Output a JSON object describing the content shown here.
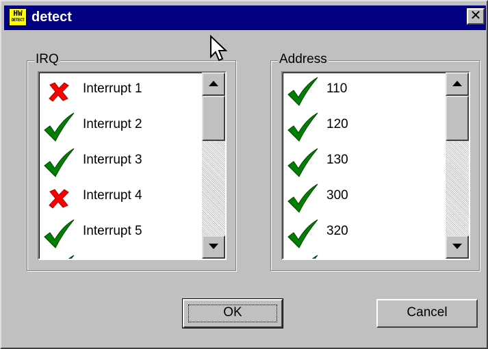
{
  "window": {
    "title": "detect",
    "icon_text_top": "HW",
    "icon_text_bottom": "DETECT",
    "close_glyph": "✕"
  },
  "irq_group": {
    "label": "IRQ",
    "items": [
      {
        "status": "fail",
        "label": "Interrupt 1"
      },
      {
        "status": "ok",
        "label": "Interrupt 2"
      },
      {
        "status": "ok",
        "label": "Interrupt 3"
      },
      {
        "status": "fail",
        "label": "Interrupt 4"
      },
      {
        "status": "ok",
        "label": "Interrupt 5"
      },
      {
        "status": "ok",
        "label": ""
      }
    ]
  },
  "address_group": {
    "label": "Address",
    "items": [
      {
        "status": "ok",
        "label": "110"
      },
      {
        "status": "ok",
        "label": "120"
      },
      {
        "status": "ok",
        "label": "130"
      },
      {
        "status": "ok",
        "label": "300"
      },
      {
        "status": "ok",
        "label": "320"
      },
      {
        "status": "ok",
        "label": ""
      }
    ]
  },
  "buttons": {
    "ok_label": "OK",
    "cancel_label": "Cancel"
  },
  "colors": {
    "titlebar": "#000080",
    "check": "#008000",
    "cross": "#ff0000"
  }
}
